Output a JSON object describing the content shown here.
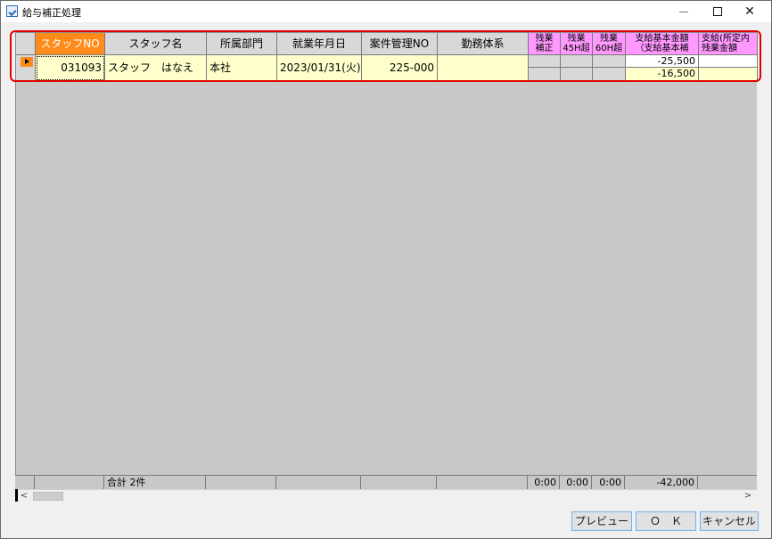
{
  "window": {
    "title": "給与補正処理"
  },
  "grid": {
    "columns": [
      "スタッフNO",
      "スタッフ名",
      "所属部門",
      "就業年月日",
      "案件管理NO",
      "勤務体系",
      "残業\n補正",
      "残業\n45H超",
      "残業\n60H超",
      "支給基本金額\n（支給基本補",
      "支給(所定内\n残業金額"
    ],
    "row": {
      "staff_no": "031093",
      "staff_name": "スタッフ　はなえ",
      "department": "本社",
      "work_date": "2023/01/31(火)",
      "project_no": "225-000",
      "work_type": "",
      "base_amount_top": "-25,500",
      "base_amount_bottom": "-16,500"
    }
  },
  "footer": {
    "total_label": "合計 2件",
    "ot_correction": "0:00",
    "ot_45h": "0:00",
    "ot_60h": "0:00",
    "base_amount_total": "-42,000"
  },
  "scrollbar": {
    "left_arrow": "<",
    "right_arrow": ">"
  },
  "buttons": {
    "preview": "プレビュー",
    "ok": "Ｏ　Ｋ",
    "cancel": "キャンセル"
  }
}
